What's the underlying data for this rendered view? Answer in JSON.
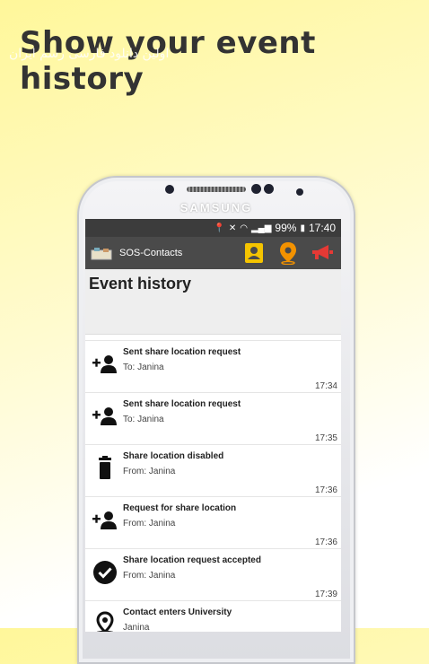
{
  "promo": {
    "headline": "Show your event history",
    "watermark": "اولین دانلود فارسی رسم ایران"
  },
  "device": {
    "brand": "SAMSUNG"
  },
  "status_bar": {
    "battery": "99%",
    "time": "17:40"
  },
  "app_bar": {
    "title": "SOS-Contacts",
    "actions": [
      {
        "icon": "contact-card-icon",
        "color": "#f5c400"
      },
      {
        "icon": "location-pin-icon",
        "color": "#f39200"
      },
      {
        "icon": "megaphone-icon",
        "color": "#e53935"
      }
    ]
  },
  "page": {
    "title": "Event history"
  },
  "events": [
    {
      "icon": "add-person-icon",
      "title": "Sent share location request",
      "subtitle": "To: Janina",
      "time": "17:34"
    },
    {
      "icon": "add-person-icon",
      "title": "Sent share location request",
      "subtitle": "To: Janina",
      "time": "17:35"
    },
    {
      "icon": "trash-icon",
      "title": "Share location disabled",
      "subtitle": "From: Janina",
      "time": "17:36"
    },
    {
      "icon": "add-person-icon",
      "title": "Request for share location",
      "subtitle": "From: Janina",
      "time": "17:36"
    },
    {
      "icon": "check-circle-icon",
      "title": "Share location request accepted",
      "subtitle": "From: Janina",
      "time": "17:39"
    },
    {
      "icon": "location-target-icon",
      "title": "Contact enters University",
      "subtitle": "Janina",
      "time": ""
    }
  ]
}
